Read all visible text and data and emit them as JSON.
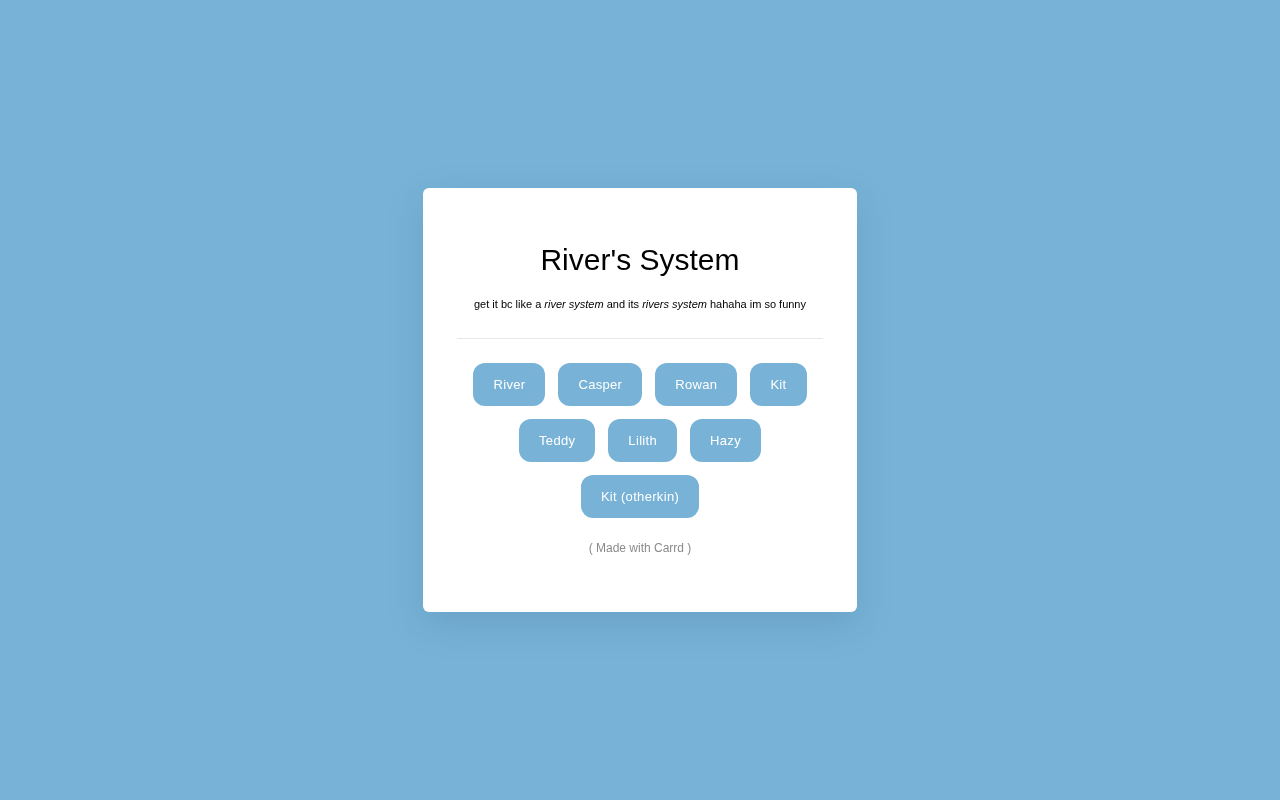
{
  "title": "River's System",
  "subtitle": "get it bc like a *river system* and its *rivers system* hahaha im so funny",
  "buttons": [
    {
      "label": "River"
    },
    {
      "label": "Casper"
    },
    {
      "label": "Rowan"
    },
    {
      "label": "Kit"
    },
    {
      "label": "Teddy"
    },
    {
      "label": "Lilith"
    },
    {
      "label": "Hazy"
    },
    {
      "label": "Kit (otherkin)"
    }
  ],
  "footer": "( Made with Carrd )"
}
